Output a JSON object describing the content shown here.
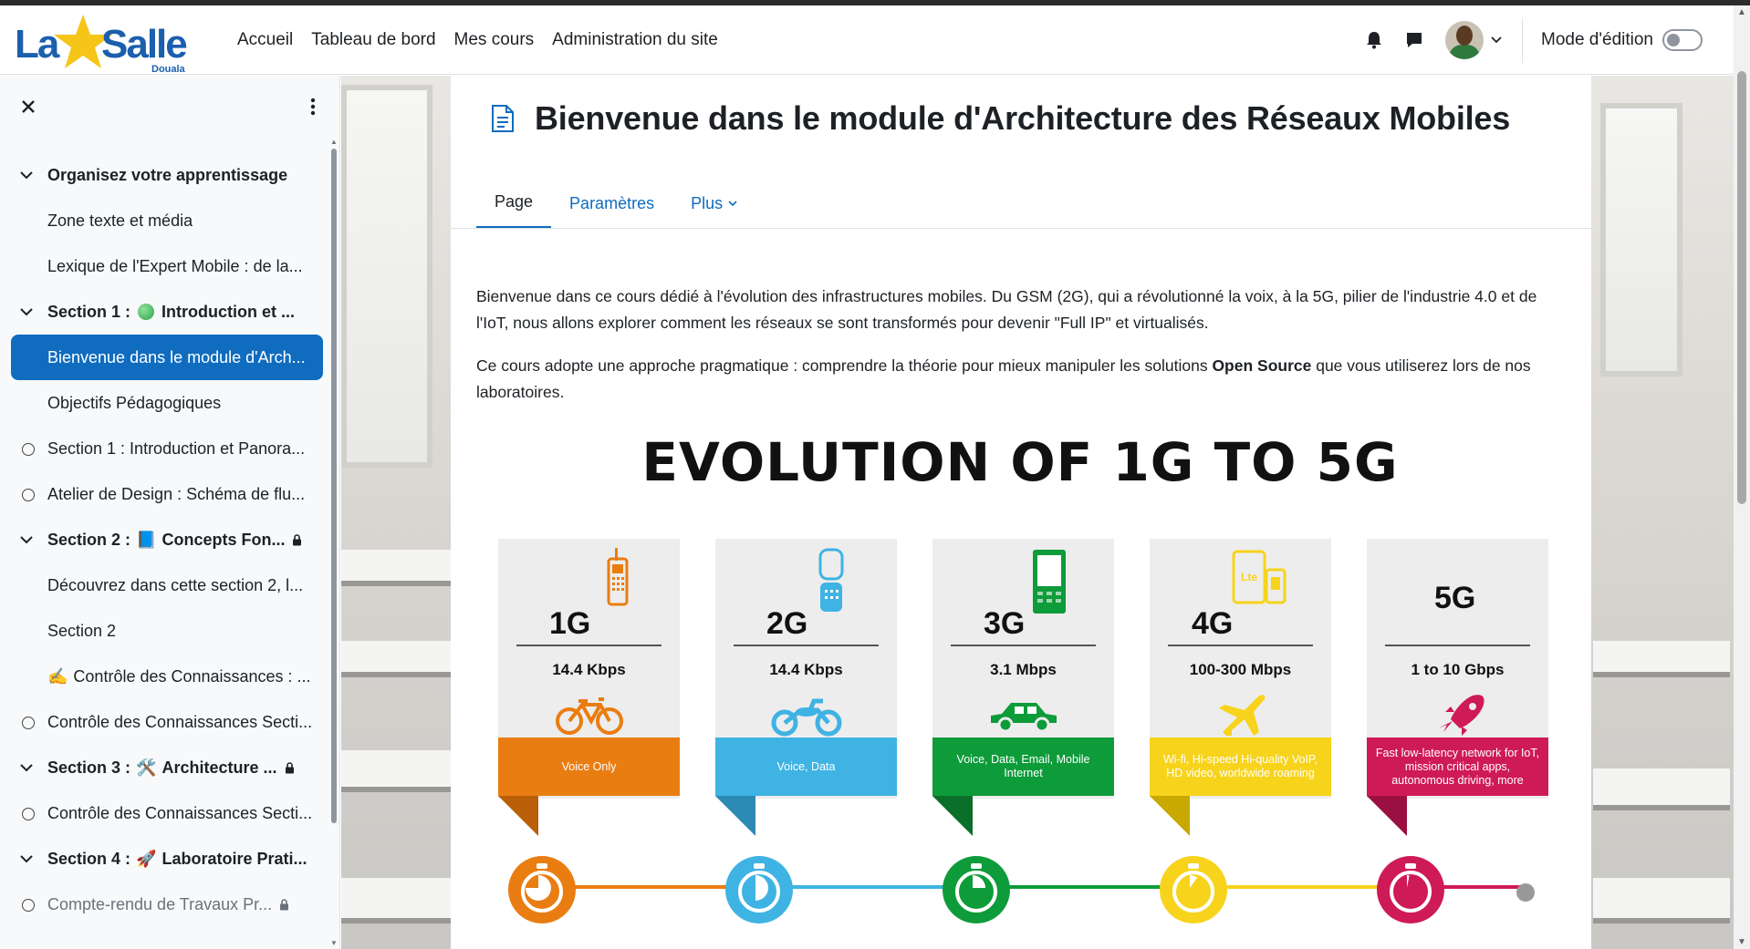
{
  "navbar": {
    "logo": {
      "word1": "La",
      "word2": "Salle",
      "sub": "Douala"
    },
    "links": [
      "Accueil",
      "Tableau de bord",
      "Mes cours",
      "Administration du site"
    ],
    "edit_mode_label": "Mode d'édition",
    "edit_mode_on": false
  },
  "drawer": {
    "items": [
      {
        "kind": "section",
        "label": "Organisez votre apprentissage"
      },
      {
        "kind": "item",
        "label": "Zone texte et média"
      },
      {
        "kind": "item",
        "label": "Lexique de l'Expert Mobile : de la..."
      },
      {
        "kind": "section",
        "prefix": "Section 1 :",
        "emoji": "green-dot",
        "label": "Introduction et ..."
      },
      {
        "kind": "item",
        "label": "Bienvenue dans le module d'Arch...",
        "active": true
      },
      {
        "kind": "item",
        "label": "Objectifs Pédagogiques"
      },
      {
        "kind": "item-circle",
        "label": "Section 1 : Introduction et Panora..."
      },
      {
        "kind": "item-circle",
        "label": "Atelier de Design : Schéma de flu..."
      },
      {
        "kind": "section",
        "prefix": "Section 2 :",
        "emoji": "📘",
        "label": "Concepts Fon...",
        "locked": true
      },
      {
        "kind": "item",
        "label": "Découvrez dans cette section 2, l..."
      },
      {
        "kind": "item",
        "label": "Section 2"
      },
      {
        "kind": "item",
        "emoji": "✍️",
        "label": "Contrôle des Connaissances : ..."
      },
      {
        "kind": "item-circle",
        "label": "Contrôle des Connaissances Secti..."
      },
      {
        "kind": "section",
        "prefix": "Section 3 :",
        "emoji": "🛠️",
        "label": "Architecture ...",
        "locked": true
      },
      {
        "kind": "item-circle",
        "label": "Contrôle des Connaissances Secti..."
      },
      {
        "kind": "section",
        "prefix": "Section 4 :",
        "emoji": "🚀",
        "label": "Laboratoire Prati..."
      },
      {
        "kind": "item-circle",
        "label": "Compte-rendu de Travaux Pr...",
        "locked": true
      }
    ]
  },
  "page": {
    "title": "Bienvenue dans le module d'Architecture des Réseaux Mobiles",
    "tabs": [
      "Page",
      "Paramètres",
      "Plus"
    ],
    "paragraph1": "Bienvenue dans ce cours dédié à l'évolution des infrastructures mobiles. Du GSM (2G), qui a révolutionné la voix, à la 5G, pilier de l'industrie 4.0 et de l'IoT, nous allons explorer comment les réseaux se sont transformés pour devenir \"Full IP\" et virtualisés.",
    "paragraph2_before": "Ce cours adopte une approche pragmatique : comprendre la théorie pour mieux manipuler les solutions ",
    "paragraph2_bold": "Open Source",
    "paragraph2_after": " que vous utiliserez lors de nos laboratoires."
  },
  "infographic": {
    "title": "EVOLUTION OF 1G TO 5G",
    "generations": [
      {
        "name": "1G",
        "speed": "14.4 Kbps",
        "vehicle": "bicycle-icon",
        "device": "brick-phone-icon",
        "band": "Voice Only",
        "color": "#e97d12"
      },
      {
        "name": "2G",
        "speed": "14.4 Kbps",
        "vehicle": "motorcycle-icon",
        "device": "flip-phone-icon",
        "band": "Voice, Data",
        "color": "#3fb3e3"
      },
      {
        "name": "3G",
        "speed": "3.1 Mbps",
        "vehicle": "car-icon",
        "device": "keypad-phone-icon",
        "band": "Voice, Data, Email, Mobile Internet",
        "color": "#0e9b3a"
      },
      {
        "name": "4G",
        "speed": "100-300 Mbps",
        "vehicle": "airplane-icon",
        "device": "lte-tablet-icon",
        "band": "Wi-fi, Hi-speed Hi-quality VoIP, HD video, worldwide roaming",
        "color": "#f7d31c"
      },
      {
        "name": "5G",
        "speed": "1 to 10 Gbps",
        "vehicle": "rocket-icon",
        "device": "",
        "band": "Fast low-latency network for IoT, mission critical apps, autonomous driving, more",
        "color": "#cf1a58"
      }
    ]
  }
}
